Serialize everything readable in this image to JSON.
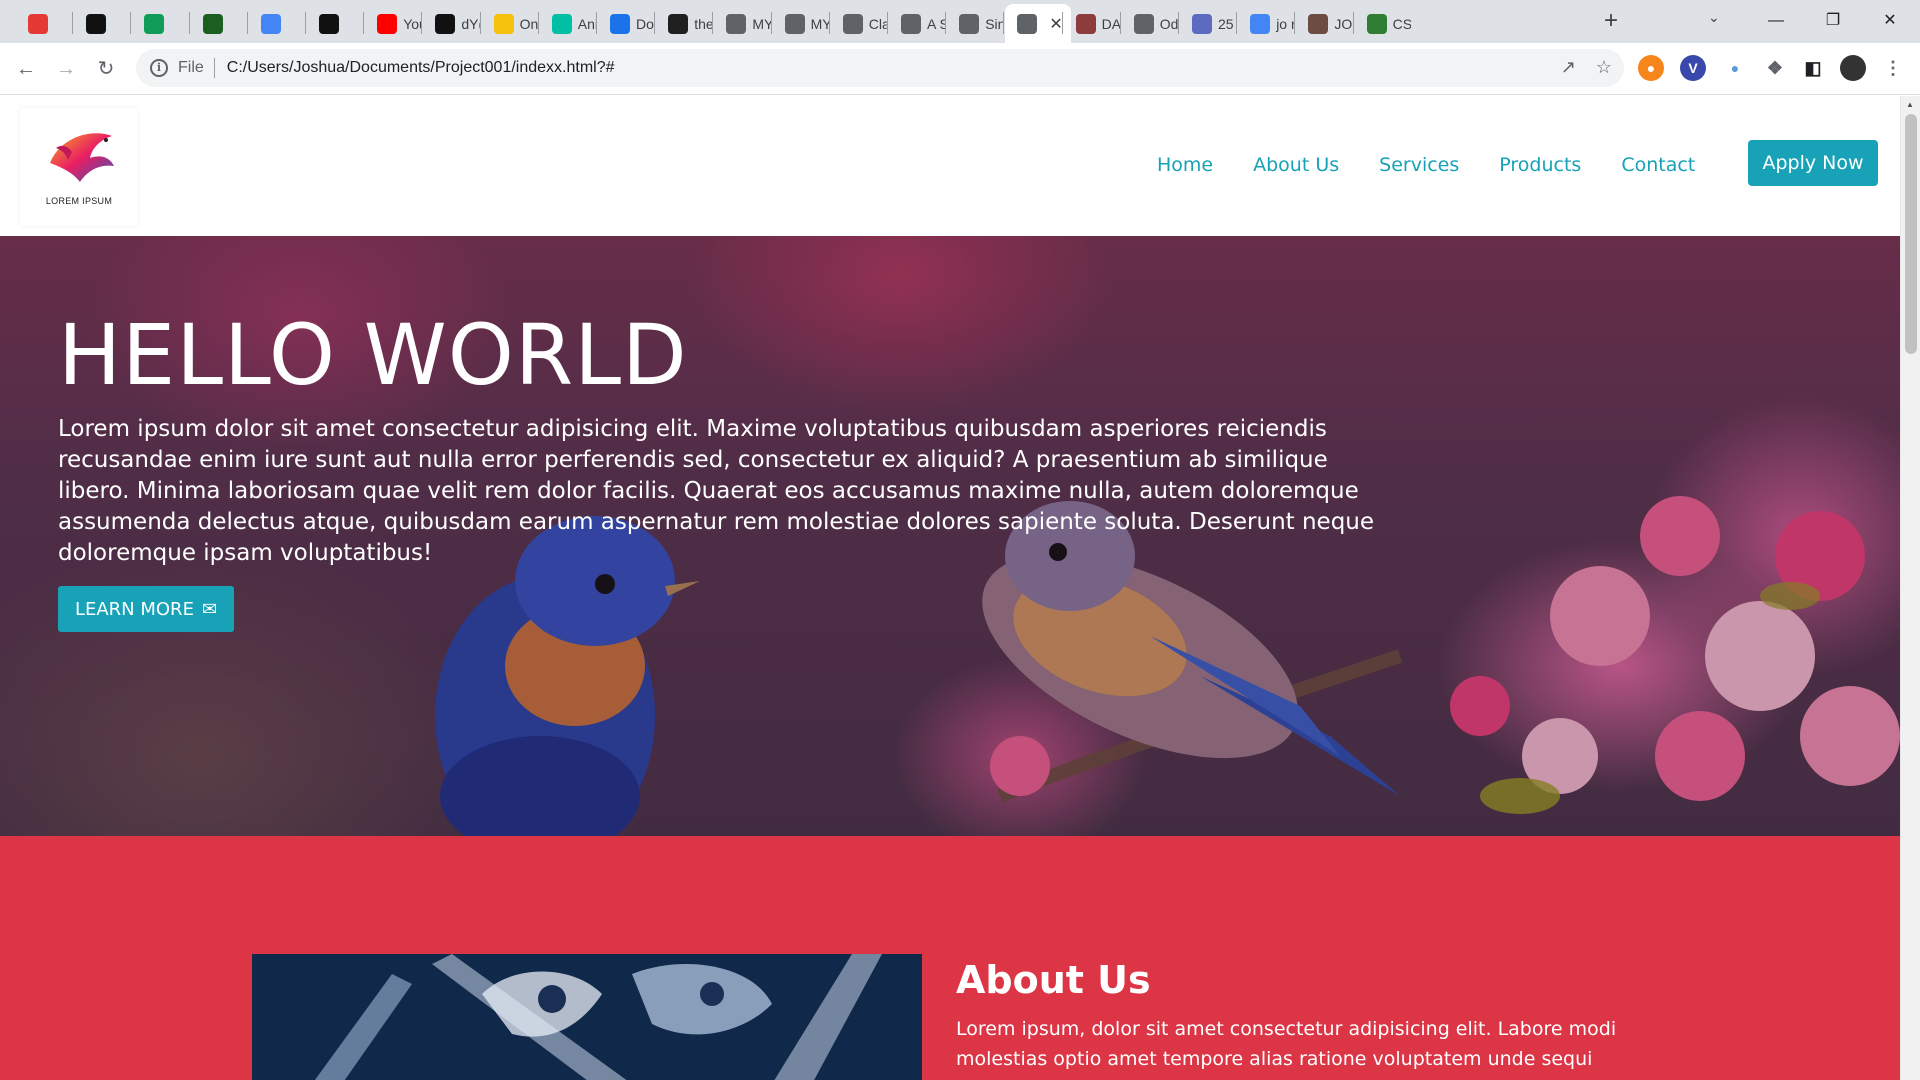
{
  "browser": {
    "tabs": [
      {
        "label": "",
        "icon": "red-swirl-icon",
        "color": "#e53935"
      },
      {
        "label": "",
        "icon": "x-icon",
        "color": "#111111"
      },
      {
        "label": "",
        "icon": "v-icon",
        "color": "#0f9d58"
      },
      {
        "label": "",
        "icon": "w-icon",
        "color": "#1b5e20"
      },
      {
        "label": "",
        "icon": "flag-icon",
        "color": "#4285f4"
      },
      {
        "label": "",
        "icon": "diamond-icon",
        "color": "#111111"
      },
      {
        "label": "You",
        "icon": "youtube-icon",
        "color": "#ff0000"
      },
      {
        "label": "dY(",
        "icon": "x-icon",
        "color": "#111111"
      },
      {
        "label": "On",
        "icon": "pikachu-icon",
        "color": "#f4c20d"
      },
      {
        "label": "Ani",
        "icon": "k-icon",
        "color": "#00bfa5"
      },
      {
        "label": "Do",
        "icon": "download-icon",
        "color": "#1a73e8"
      },
      {
        "label": "the",
        "icon": "dark-icon",
        "color": "#202020"
      },
      {
        "label": "MY",
        "icon": "globe-icon",
        "color": "#5f6368"
      },
      {
        "label": "MY",
        "icon": "globe-icon",
        "color": "#5f6368"
      },
      {
        "label": "Cla",
        "icon": "globe-icon",
        "color": "#5f6368"
      },
      {
        "label": "A S",
        "icon": "globe-icon",
        "color": "#5f6368"
      },
      {
        "label": "Sin",
        "icon": "globe-icon",
        "color": "#5f6368"
      },
      {
        "label": "",
        "icon": "globe-icon",
        "color": "#5f6368",
        "active": true
      },
      {
        "label": "DA",
        "icon": "avatar-icon",
        "color": "#8d3b3b"
      },
      {
        "label": "Od",
        "icon": "globe-icon",
        "color": "#5f6368"
      },
      {
        "label": "25",
        "icon": "h-icon",
        "color": "#5c6bc0"
      },
      {
        "label": "jo r",
        "icon": "google-icon",
        "color": "#4285f4"
      },
      {
        "label": "JO",
        "icon": "face-icon",
        "color": "#6d4c41"
      },
      {
        "label": "CS",
        "icon": "w-icon",
        "color": "#2e7d32"
      }
    ],
    "address": {
      "scheme": "File",
      "url": "C:/Users/Joshua/Documents/Project001/indexx.html?#"
    }
  },
  "header": {
    "logo_text": "LOREM IPSUM",
    "nav": [
      "Home",
      "About Us",
      "Services",
      "Products",
      "Contact"
    ],
    "apply_label": "Apply Now"
  },
  "hero": {
    "title": "HELLO WORLD",
    "text": "Lorem ipsum dolor sit amet consectetur adipisicing elit. Maxime voluptatibus quibusdam asperiores reiciendis recusandae enim iure sunt aut nulla error perferendis sed, consectetur ex aliquid? A praesentium ab similique libero. Minima laboriosam quae velit rem dolor facilis. Quaerat eos accusamus maxime nulla, autem doloremque assumenda delectus atque, quibusdam earum aspernatur rem molestiae dolores sapiente soluta. Deserunt neque doloremque ipsam voluptatibus!",
    "button_label": "LEARN MORE"
  },
  "about": {
    "title": "About Us",
    "text": "Lorem ipsum, dolor sit amet consectetur adipisicing elit. Labore modi molestias optio amet tempore alias ratione voluptatem unde sequi ducimus"
  },
  "colors": {
    "accent": "#17a2b8",
    "about_bg": "#dc3545"
  }
}
